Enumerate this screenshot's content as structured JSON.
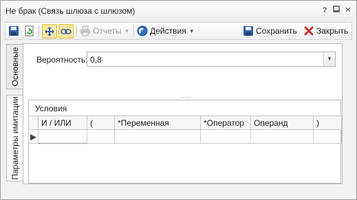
{
  "window": {
    "title": "Не брак (Связь шлюза с шлюзом)",
    "buttons": {
      "help": "?",
      "minimize": "▫",
      "maximize": "□",
      "close": "✕"
    }
  },
  "toolbar": {
    "reports_label": "Отчеты",
    "actions_label": "Действия",
    "save_label": "Сохранить",
    "close_label": "Закрыть"
  },
  "tabs": [
    {
      "label": "Основные"
    },
    {
      "label": "Параметры имитации"
    }
  ],
  "form": {
    "probability_label": "Вероятность:",
    "probability_value": "0,8"
  },
  "conditions": {
    "title": "Условия",
    "columns": [
      "И / ИЛИ",
      "(",
      "*Переменная",
      "*Оператор",
      "Операнд",
      ")"
    ],
    "rows": [
      [
        "",
        "",
        "",
        "",
        "",
        ""
      ]
    ]
  },
  "icons": {
    "save": "floppy-disk-icon",
    "refresh": "refresh-icon",
    "expand": "expand-icon",
    "link": "link-icon",
    "print": "printer-icon",
    "actions": "globe-icon",
    "close": "red-x-icon"
  }
}
